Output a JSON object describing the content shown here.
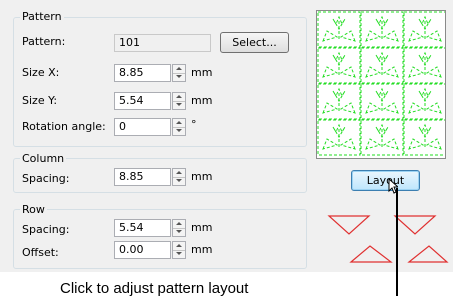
{
  "pattern": {
    "title": "Pattern",
    "pattern_label": "Pattern:",
    "pattern_value": "101",
    "select_label": "Select...",
    "size_x_label": "Size X:",
    "size_x_value": "8.85",
    "size_x_unit": "mm",
    "size_y_label": "Size Y:",
    "size_y_value": "5.54",
    "size_y_unit": "mm",
    "rotation_label": "Rotation angle:",
    "rotation_value": "0",
    "rotation_unit": "°"
  },
  "column": {
    "title": "Column",
    "spacing_label": "Spacing:",
    "spacing_value": "8.85",
    "spacing_unit": "mm"
  },
  "row": {
    "title": "Row",
    "spacing_label": "Spacing:",
    "spacing_value": "5.54",
    "spacing_unit": "mm",
    "offset_label": "Offset:",
    "offset_value": "0.00",
    "offset_unit": "mm"
  },
  "layout_button_label": "Layout",
  "caption": "Click to adjust pattern layout",
  "colors": {
    "pattern_stroke": "#22dd22",
    "arrow_stroke": "#e03030",
    "dialog_bg": "#f0f0f0"
  },
  "icons": [
    "spin-up-icon",
    "spin-down-icon",
    "mouse-cursor-icon",
    "pointer-line-icon"
  ]
}
